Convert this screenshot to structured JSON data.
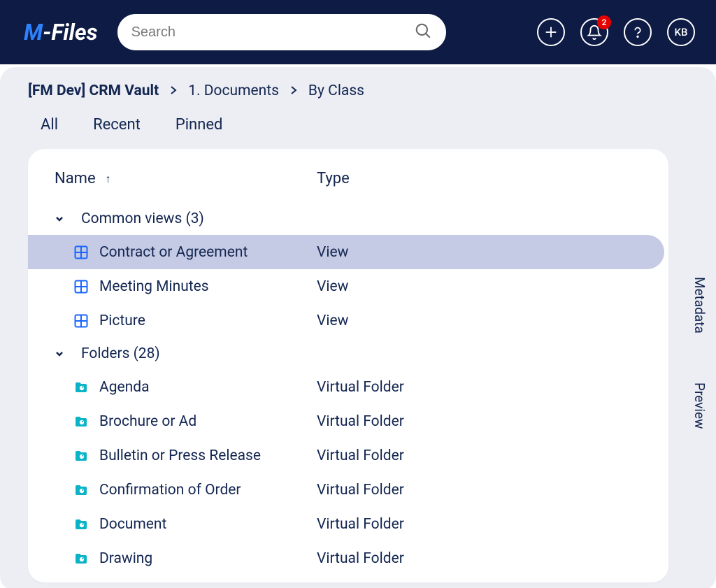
{
  "logo": {
    "part1": "M",
    "part2": "-Files"
  },
  "search": {
    "placeholder": "Search"
  },
  "notifications": {
    "count": "2"
  },
  "avatar": "KB",
  "breadcrumb": [
    {
      "label": "[FM Dev] CRM Vault",
      "bold": true
    },
    {
      "label": "1. Documents",
      "bold": false
    },
    {
      "label": "By Class",
      "bold": false
    }
  ],
  "tabs": [
    {
      "label": "All"
    },
    {
      "label": "Recent"
    },
    {
      "label": "Pinned"
    }
  ],
  "columns": {
    "name": "Name",
    "type": "Type"
  },
  "groups": [
    {
      "label": "Common views (3)",
      "items": [
        {
          "name": "Contract or Agreement",
          "type": "View",
          "icon": "view",
          "selected": true
        },
        {
          "name": "Meeting Minutes",
          "type": "View",
          "icon": "view",
          "selected": false
        },
        {
          "name": "Picture",
          "type": "View",
          "icon": "view",
          "selected": false
        }
      ]
    },
    {
      "label": "Folders (28)",
      "items": [
        {
          "name": "Agenda",
          "type": "Virtual Folder",
          "icon": "folder",
          "selected": false
        },
        {
          "name": "Brochure or Ad",
          "type": "Virtual Folder",
          "icon": "folder",
          "selected": false
        },
        {
          "name": "Bulletin or Press Release",
          "type": "Virtual Folder",
          "icon": "folder",
          "selected": false
        },
        {
          "name": "Confirmation of Order",
          "type": "Virtual Folder",
          "icon": "folder",
          "selected": false
        },
        {
          "name": "Document",
          "type": "Virtual Folder",
          "icon": "folder",
          "selected": false
        },
        {
          "name": "Drawing",
          "type": "Virtual Folder",
          "icon": "folder",
          "selected": false
        }
      ]
    }
  ],
  "side_tabs": [
    {
      "label": "Metadata"
    },
    {
      "label": "Preview"
    }
  ]
}
